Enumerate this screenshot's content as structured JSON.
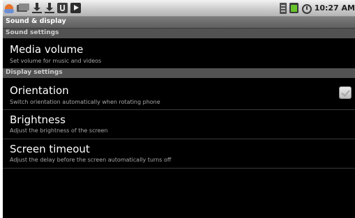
{
  "status_bar": {
    "left_icons": [
      "notification-face-icon",
      "mail-icon",
      "download-icon",
      "download-icon",
      "usb-icon",
      "media-play-icon"
    ],
    "right_icons": [
      "signal-icon",
      "battery-icon",
      "alarm-icon"
    ],
    "time": "10:27 AM",
    "battery_color": "#67c52b"
  },
  "title": "Sound & display",
  "sections": {
    "sound": {
      "header": "Sound settings"
    },
    "display": {
      "header": "Display settings"
    }
  },
  "items": {
    "media_volume": {
      "title": "Media volume",
      "summary": "Set volume for music and videos"
    },
    "orientation": {
      "title": "Orientation",
      "summary": "Switch orientation automatically when rotating phone",
      "checked": true
    },
    "brightness": {
      "title": "Brightness",
      "summary": "Adjust the brightness of the screen"
    },
    "screen_timeout": {
      "title": "Screen timeout",
      "summary": "Adjust the delay before the screen automatically turns off"
    }
  }
}
